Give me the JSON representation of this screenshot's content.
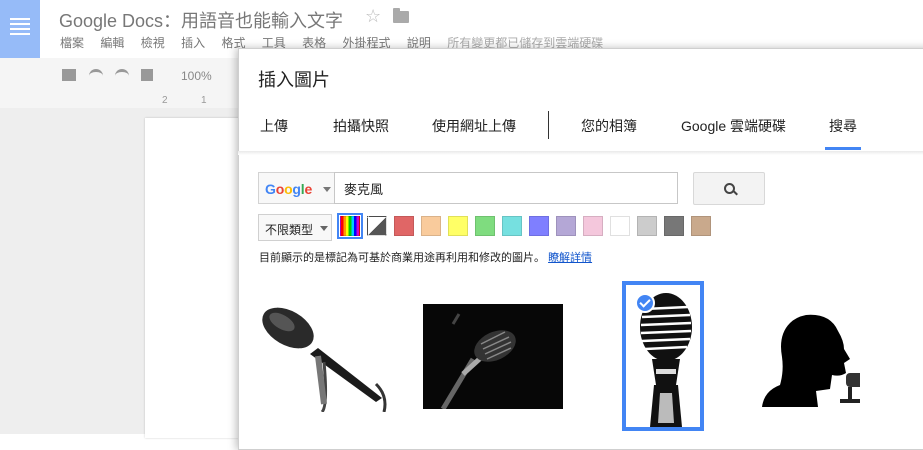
{
  "app": {
    "title": "Google Docs：用語音也能輸入文字",
    "menu": [
      "檔案",
      "編輯",
      "檢視",
      "插入",
      "格式",
      "工具",
      "表格",
      "外掛程式",
      "說明"
    ],
    "save_status": "所有變更都已儲存到雲端硬碟",
    "zoom": "100%",
    "ruler_marks": [
      "2",
      "1"
    ]
  },
  "dialog": {
    "title": "插入圖片",
    "tabs": [
      "上傳",
      "拍攝快照",
      "使用網址上傳",
      "您的相簿",
      "Google 雲端硬碟",
      "搜尋"
    ],
    "active_tab": "搜尋",
    "search": {
      "provider": [
        "G",
        "o",
        "o",
        "g",
        "l",
        "e"
      ],
      "query": "麥克風"
    },
    "filter": {
      "type_label": "不限類型",
      "colors": [
        "#d9d9d9",
        "#e06666",
        "#f9cb9c",
        "#ffff66",
        "#7fdc7f",
        "#76e0e0",
        "#7f7fff",
        "#b4a7d6",
        "#f4c7dc",
        "#ffffff",
        "#cccccc",
        "#777777",
        "#c9a98c"
      ]
    },
    "notice": "目前顯示的是標記為可基於商業用途再利用和修改的圖片。",
    "notice_link": "瞭解詳情",
    "results": [
      "mic-handheld",
      "mic-dark-stand",
      "mic-vintage",
      "silhouette-speaker"
    ],
    "selected_result": "mic-vintage"
  },
  "colors": {
    "accent": "#4285f4",
    "link": "#1155cc"
  }
}
